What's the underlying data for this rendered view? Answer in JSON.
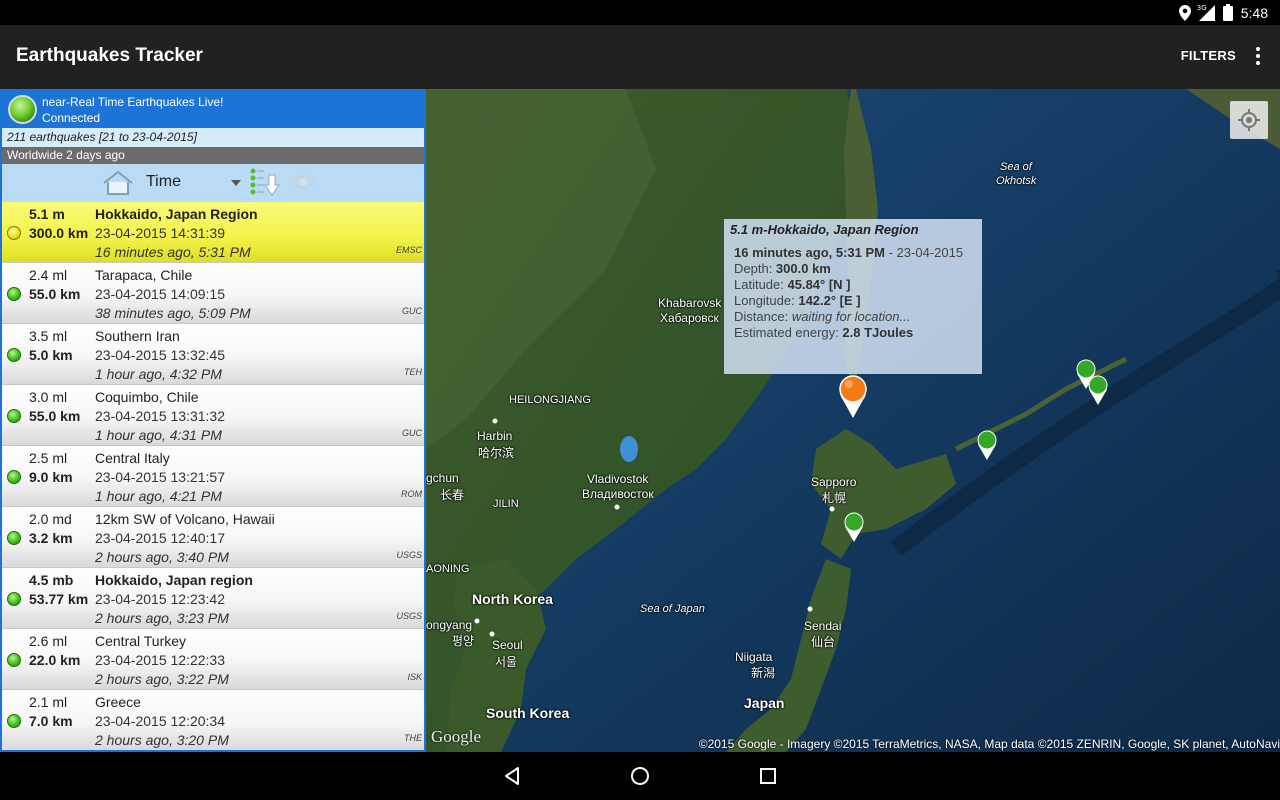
{
  "status": {
    "network": "3G",
    "time": "5:48"
  },
  "app": {
    "title": "Earthquakes Tracker",
    "filters_label": "FILTERS"
  },
  "connection": {
    "line1": "near-Real Time Earthquakes Live!",
    "line2": "Connected"
  },
  "summary": {
    "count_text": "211 earthquakes [21 to 23-04-2015]",
    "region_text": "Worldwide 2 days ago"
  },
  "sort": {
    "label": "Time"
  },
  "quakes": [
    {
      "mag": "5.1 m",
      "depth": "300.0 km",
      "location": "Hokkaido, Japan Region",
      "datetime": "23-04-2015 14:31:39",
      "ago": "16 minutes ago, 5:31 PM",
      "source": "EMSC"
    },
    {
      "mag": "2.4 ml",
      "depth": "55.0 km",
      "location": "Tarapaca, Chile",
      "datetime": "23-04-2015 14:09:15",
      "ago": "38 minutes ago, 5:09 PM",
      "source": "GUC"
    },
    {
      "mag": "3.5 ml",
      "depth": "5.0 km",
      "location": "Southern Iran",
      "datetime": "23-04-2015 13:32:45",
      "ago": "1 hour ago, 4:32 PM",
      "source": "TEH"
    },
    {
      "mag": "3.0 ml",
      "depth": "55.0 km",
      "location": "Coquimbo, Chile",
      "datetime": "23-04-2015 13:31:32",
      "ago": "1 hour ago, 4:31 PM",
      "source": "GUC"
    },
    {
      "mag": "2.5 ml",
      "depth": "9.0 km",
      "location": "Central Italy",
      "datetime": "23-04-2015 13:21:57",
      "ago": "1 hour ago, 4:21 PM",
      "source": "ROM"
    },
    {
      "mag": "2.0 md",
      "depth": "3.2 km",
      "location": "12km SW of Volcano, Hawaii",
      "datetime": "23-04-2015 12:40:17",
      "ago": "2 hours ago, 3:40 PM",
      "source": "USGS"
    },
    {
      "mag": "4.5 mb",
      "depth": "53.77 km",
      "location": "Hokkaido, Japan region",
      "datetime": "23-04-2015 12:23:42",
      "ago": "2 hours ago, 3:23 PM",
      "source": "USGS"
    },
    {
      "mag": "2.6 ml",
      "depth": "22.0 km",
      "location": "Central Turkey",
      "datetime": "23-04-2015 12:22:33",
      "ago": "2 hours ago, 3:22 PM",
      "source": "ISK"
    },
    {
      "mag": "2.1 ml",
      "depth": "7.0 km",
      "location": "Greece",
      "datetime": "23-04-2015 12:20:34",
      "ago": "2 hours ago, 3:20 PM",
      "source": "THE"
    }
  ],
  "map": {
    "labels": {
      "sea_okhotsk_1": "Sea of",
      "sea_okhotsk_2": "Okhotsk",
      "khabarovsk_en": "Khabarovsk",
      "khabarovsk_ru": "Хабаровск",
      "heilongjiang": "HEILONGJIANG",
      "harbin_en": "Harbin",
      "harbin_zh": "哈尔滨",
      "vladivostok_en": "Vladivostok",
      "vladivostok_ru": "Владивосток",
      "changchun_en": "gchun",
      "changchun_zh": "长春",
      "jilin": "JILIN",
      "liaoning": "AONING",
      "sapporo_en": "Sapporo",
      "sapporo_ja": "札幌",
      "north_korea": "North Korea",
      "sea_japan": "Sea of Japan",
      "pyongyang_en": "ongyang",
      "pyongyang_ko": "평양",
      "seoul_en": "Seoul",
      "seoul_ko": "서울",
      "sendai_en": "Sendai",
      "sendai_ja": "仙台",
      "niigata_en": "Niigata",
      "niigata_ja": "新潟",
      "south_korea": "South Korea",
      "japan": "Japan"
    },
    "info": {
      "title": "5.1 m-Hokkaido, Japan Region",
      "time_bold": "16 minutes ago, 5:31 PM",
      "time_rest": " - 23-04-2015",
      "depth_label": "Depth: ",
      "depth_value": "300.0 km",
      "lat_label": "Latitude: ",
      "lat_value": "45.84° [N ]",
      "lon_label": "Longitude: ",
      "lon_value": "142.2° [E ]",
      "dist_label": "Distance: ",
      "dist_value": "waiting for location...",
      "energy_label": "Estimated energy: ",
      "energy_value": "2.8 TJoules"
    },
    "google_logo": "Google",
    "attribution": "©2015 Google - Imagery ©2015 TerraMetrics, NASA, Map data ©2015 ZENRIN, Google, SK planet, AutoNavi"
  }
}
